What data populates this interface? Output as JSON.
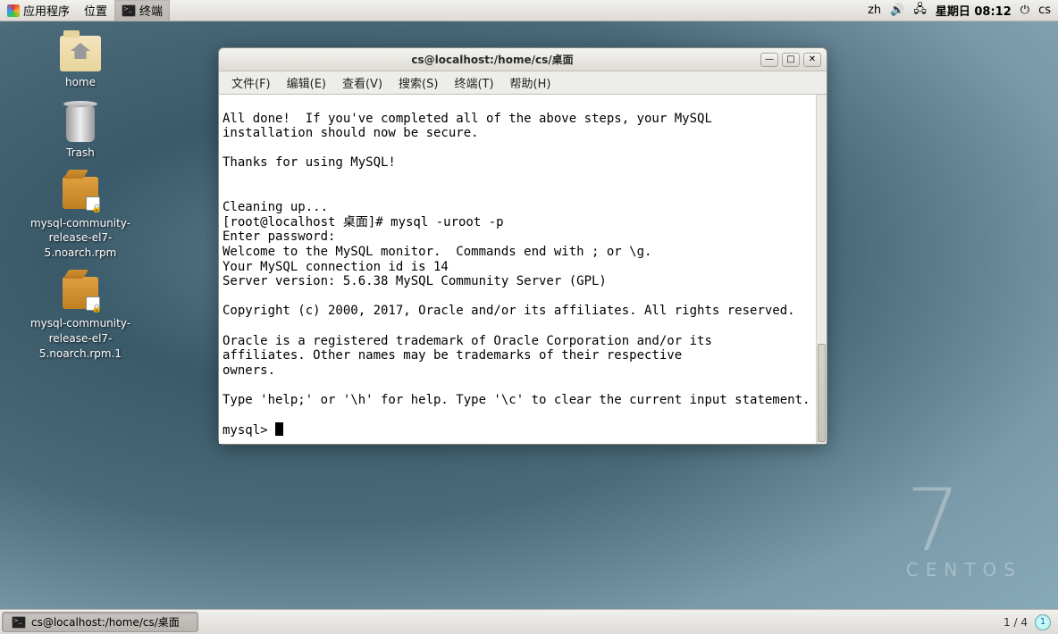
{
  "panel": {
    "applications": "应用程序",
    "places": "位置",
    "active_app": "终端",
    "ime": "zh",
    "clock": "星期日 08:12",
    "user": "cs"
  },
  "desktop": {
    "home": "home",
    "trash": "Trash",
    "pkg1": "mysql-community-release-el7-5.noarch.rpm",
    "pkg2": "mysql-community-release-el7-5.noarch.rpm.1"
  },
  "centos": {
    "seven": "7",
    "name": "CENTOS"
  },
  "terminal": {
    "title": "cs@localhost:/home/cs/桌面",
    "menu": {
      "file": "文件(F)",
      "edit": "编辑(E)",
      "view": "查看(V)",
      "search": "搜索(S)",
      "terminal": "终端(T)",
      "help": "帮助(H)"
    },
    "lines": [
      "",
      "All done!  If you've completed all of the above steps, your MySQL",
      "installation should now be secure.",
      "",
      "Thanks for using MySQL!",
      "",
      "",
      "Cleaning up...",
      "[root@localhost 桌面]# mysql -uroot -p",
      "Enter password: ",
      "Welcome to the MySQL monitor.  Commands end with ; or \\g.",
      "Your MySQL connection id is 14",
      "Server version: 5.6.38 MySQL Community Server (GPL)",
      "",
      "Copyright (c) 2000, 2017, Oracle and/or its affiliates. All rights reserved.",
      "",
      "Oracle is a registered trademark of Oracle Corporation and/or its",
      "affiliates. Other names may be trademarks of their respective",
      "owners.",
      "",
      "Type 'help;' or '\\h' for help. Type '\\c' to clear the current input statement.",
      "",
      "mysql> "
    ]
  },
  "taskbar": {
    "task1": "cs@localhost:/home/cs/桌面",
    "workspaces": "1 / 4",
    "ws_current": "1"
  }
}
